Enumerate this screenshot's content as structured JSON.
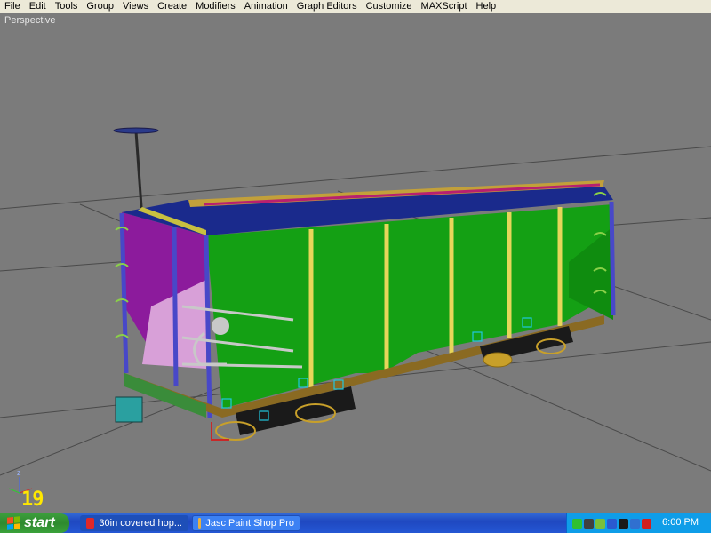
{
  "menu": [
    "File",
    "Edit",
    "Tools",
    "Group",
    "Views",
    "Create",
    "Modifiers",
    "Animation",
    "Graph Editors",
    "Customize",
    "MAXScript",
    "Help"
  ],
  "viewport": {
    "label": "Perspective",
    "frame": "19",
    "axis_label": "z",
    "background": "#7b7b7b"
  },
  "model": {
    "colors": {
      "body_green": "#14a014",
      "end_purple": "#8c1b9c",
      "roof_navy": "#1a2a8c",
      "frame_tan": "#8a6a22",
      "roof_walk": "#c2a03a",
      "post_blue": "#4848c8",
      "rib_yellow": "#e6d65a",
      "truck": "#1a1a1a"
    }
  },
  "taskbar": {
    "start_label": "start",
    "items": [
      {
        "label": "30in covered hop...",
        "icon": "3dsmax-icon",
        "active": true
      },
      {
        "label": "Jasc Paint Shop Pro",
        "icon": "paintshop-icon",
        "active": false
      }
    ],
    "clock": "6:00 PM"
  }
}
